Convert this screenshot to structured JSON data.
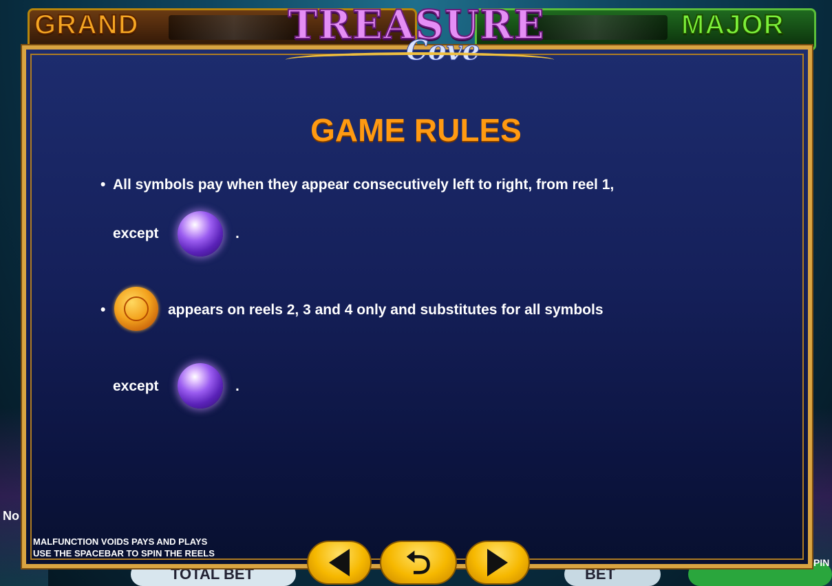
{
  "jackpots": {
    "grand_label": "GRAND",
    "major_label": "MAJOR"
  },
  "logo": {
    "main": "TREASURE",
    "sub": "Cove"
  },
  "panel": {
    "title": "GAME RULES",
    "rule1": {
      "bullet": "•",
      "line1": "All symbols pay when they appear consecutively left to right, from reel 1,",
      "except": "except",
      "period": ".",
      "icon": "pearl-scatter-icon"
    },
    "rule2": {
      "bullet": "•",
      "text": "appears on reels 2, 3 and 4 only and substitutes for all symbols",
      "except": "except",
      "period": ".",
      "wild_icon": "gold-coin-wild-icon",
      "icon": "pearl-scatter-icon"
    },
    "disclaimer": {
      "line1": "MALFUNCTION VOIDS PAYS AND PLAYS",
      "line2": "USE THE SPACEBAR TO SPIN THE REELS"
    }
  },
  "nav": {
    "prev_icon": "arrow-left-icon",
    "return_icon": "return-icon",
    "next_icon": "arrow-right-icon"
  },
  "background": {
    "total_bet": "TOTAL BET",
    "bet": "BET",
    "left_label": "No",
    "right_label": "PIN"
  },
  "colors": {
    "title": "#ff9a12",
    "panel_bg": "#15205a",
    "frame": "#d9a441",
    "button": "#f6b800"
  }
}
